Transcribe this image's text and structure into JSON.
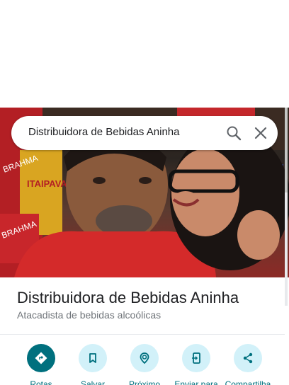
{
  "search": {
    "query": "Distribuidora de Bebidas Aninha"
  },
  "hero": {
    "signs": [
      "BRAHMA",
      "BRAHMA",
      "ITAIPAVA"
    ]
  },
  "place": {
    "title": "Distribuidora de Bebidas Aninha",
    "category": "Atacadista de bebidas alcoólicas"
  },
  "actions": [
    {
      "label": "Rotas",
      "icon": "directions-icon"
    },
    {
      "label": "Salvar",
      "icon": "bookmark-icon"
    },
    {
      "label": "Próximo",
      "icon": "nearby-icon"
    },
    {
      "label": "Enviar para",
      "icon": "send-to-phone-icon"
    },
    {
      "label": "Compartilha",
      "icon": "share-icon"
    }
  ],
  "colors": {
    "accent": "#00707e",
    "action_bg": "#d2f1f9",
    "shirt_red": "#d42a2a"
  }
}
